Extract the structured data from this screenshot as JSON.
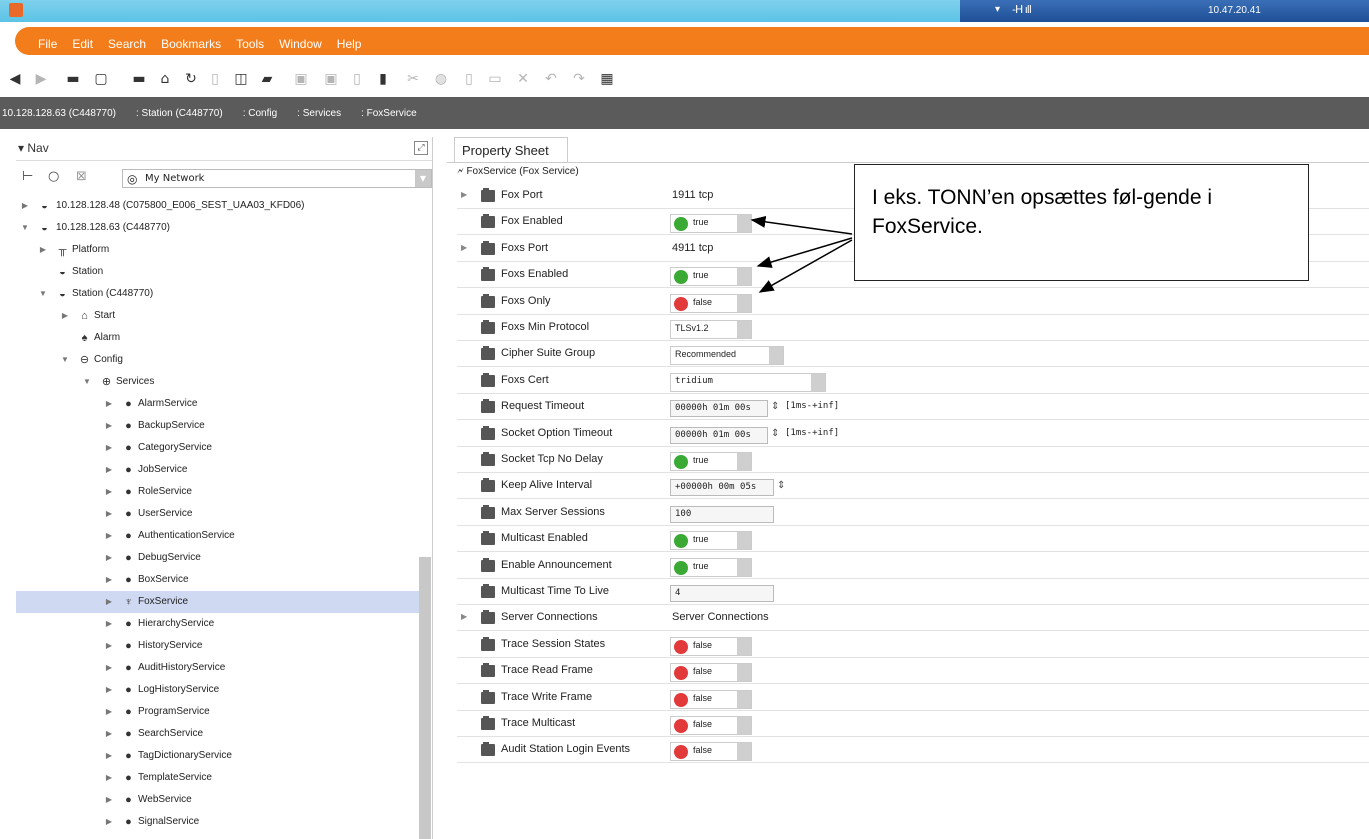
{
  "titlebar": {
    "ip": "10.47.20.41"
  },
  "menu": [
    "File",
    "Edit",
    "Search",
    "Bookmarks",
    "Tools",
    "Window",
    "Help"
  ],
  "breadcrumb": [
    "10.128.128.63 (C448770)",
    ": Station (C448770)",
    ": Config",
    ": Services",
    ": FoxService"
  ],
  "nav": {
    "title": "Nav",
    "combo": "My Network",
    "tree": [
      {
        "label": "10.128.128.48 (C075800_E006_SEST_UAA03_KFD06)",
        "icon": "station-icon"
      },
      {
        "label": "10.128.128.63 (C448770)",
        "icon": "station-icon"
      },
      {
        "label": "Platform",
        "icon": "platform-icon"
      },
      {
        "label": "Station",
        "icon": "station-icon"
      },
      {
        "label": "Station (C448770)",
        "icon": "station-icon"
      },
      {
        "label": "Start",
        "icon": "home-icon"
      },
      {
        "label": "Alarm",
        "icon": "bell-icon"
      },
      {
        "label": "Config",
        "icon": "config-icon"
      },
      {
        "label": "Services",
        "icon": "services-icon"
      },
      {
        "label": "AlarmService",
        "icon": "service-icon"
      },
      {
        "label": "BackupService",
        "icon": "service-icon"
      },
      {
        "label": "CategoryService",
        "icon": "service-icon"
      },
      {
        "label": "JobService",
        "icon": "service-icon"
      },
      {
        "label": "RoleService",
        "icon": "service-icon"
      },
      {
        "label": "UserService",
        "icon": "service-icon"
      },
      {
        "label": "AuthenticationService",
        "icon": "service-icon"
      },
      {
        "label": "DebugService",
        "icon": "service-icon"
      },
      {
        "label": "BoxService",
        "icon": "service-icon"
      },
      {
        "label": "FoxService",
        "icon": "fox-icon"
      },
      {
        "label": "HierarchyService",
        "icon": "service-icon"
      },
      {
        "label": "HistoryService",
        "icon": "service-icon"
      },
      {
        "label": "AuditHistoryService",
        "icon": "service-icon"
      },
      {
        "label": "LogHistoryService",
        "icon": "service-icon"
      },
      {
        "label": "ProgramService",
        "icon": "service-icon"
      },
      {
        "label": "SearchService",
        "icon": "service-icon"
      },
      {
        "label": "TagDictionaryService",
        "icon": "service-icon"
      },
      {
        "label": "TemplateService",
        "icon": "service-icon"
      },
      {
        "label": "WebService",
        "icon": "service-icon"
      },
      {
        "label": "SignalService",
        "icon": "service-icon"
      }
    ]
  },
  "sheet": {
    "tab": "Property Sheet",
    "root": "FoxService  (Fox Service)",
    "props": [
      {
        "name": "Fox Port",
        "value": "1911 tcp",
        "kind": "text"
      },
      {
        "name": "Fox Enabled",
        "value": "true",
        "kind": "bool"
      },
      {
        "name": "Foxs Port",
        "value": "4911 tcp",
        "kind": "text"
      },
      {
        "name": "Foxs Enabled",
        "value": "true",
        "kind": "bool"
      },
      {
        "name": "Foxs Only",
        "value": "false",
        "kind": "bool"
      },
      {
        "name": "Foxs Min Protocol",
        "value": "TLSv1.2",
        "kind": "select"
      },
      {
        "name": "Cipher Suite Group",
        "value": "Recommended",
        "kind": "select"
      },
      {
        "name": "Foxs Cert",
        "value": "tridium",
        "kind": "select"
      },
      {
        "name": "Request Timeout",
        "value": "00000h 01m 00s",
        "kind": "duration",
        "range": "[1ms-+inf]"
      },
      {
        "name": "Socket Option Timeout",
        "value": "00000h 01m 00s",
        "kind": "duration",
        "range": "[1ms-+inf]"
      },
      {
        "name": "Socket Tcp No Delay",
        "value": "true",
        "kind": "bool"
      },
      {
        "name": "Keep Alive Interval",
        "value": "+00000h 00m 05s",
        "kind": "duration",
        "range": ""
      },
      {
        "name": "Max Server Sessions",
        "value": "100",
        "kind": "input"
      },
      {
        "name": "Multicast Enabled",
        "value": "true",
        "kind": "bool"
      },
      {
        "name": "Enable Announcement",
        "value": "true",
        "kind": "bool"
      },
      {
        "name": "Multicast Time To Live",
        "value": "4",
        "kind": "input"
      },
      {
        "name": "Server Connections",
        "value": "Server Connections",
        "kind": "text"
      },
      {
        "name": "Trace Session States",
        "value": "false",
        "kind": "bool"
      },
      {
        "name": "Trace Read Frame",
        "value": "false",
        "kind": "bool"
      },
      {
        "name": "Trace Write Frame",
        "value": "false",
        "kind": "bool"
      },
      {
        "name": "Trace Multicast",
        "value": "false",
        "kind": "bool"
      },
      {
        "name": "Audit Station Login Events",
        "value": "false",
        "kind": "bool"
      }
    ]
  },
  "callout": "I eks. TONN’en opsættes føl-gende i FoxService.",
  "colors": {
    "accent": "#f37d1b",
    "true": "#3aaa35",
    "false": "#e23a3a",
    "selection": "#cfd9f2"
  }
}
